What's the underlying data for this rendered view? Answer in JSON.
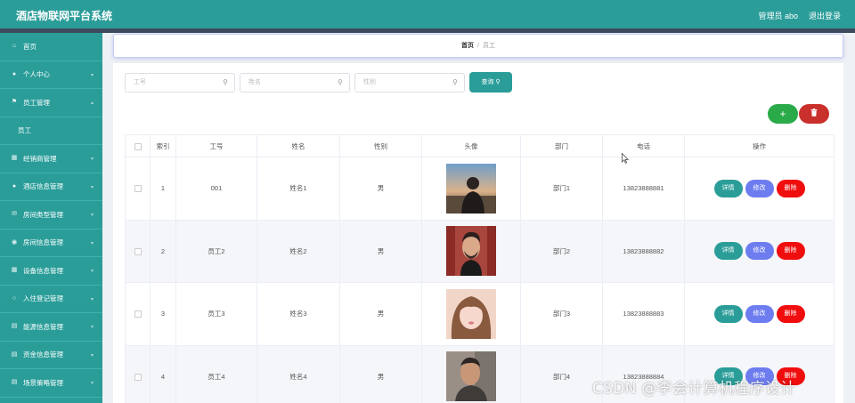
{
  "header": {
    "title": "酒店物联网平台系统",
    "admin": "管理员 abo",
    "logout": "退出登录"
  },
  "colors": {
    "primary": "#2a9d99",
    "success": "#2aaa49",
    "danger": "#c9302c",
    "edit": "#6d7df0",
    "delete": "#f00d0d"
  },
  "sidebar": {
    "items": [
      {
        "label": "首页",
        "icon": "home-icon"
      },
      {
        "label": "个人中心",
        "icon": "user-icon"
      },
      {
        "label": "员工管理",
        "icon": "flag-icon"
      },
      {
        "label": "员工",
        "icon": ""
      },
      {
        "label": "经销商管理",
        "icon": "store-icon"
      },
      {
        "label": "酒店信息管理",
        "icon": "user-icon"
      },
      {
        "label": "房间类型管理",
        "icon": "mail-icon"
      },
      {
        "label": "房间信息管理",
        "icon": "location-icon"
      },
      {
        "label": "设备信息管理",
        "icon": "grid-icon"
      },
      {
        "label": "入住登记管理",
        "icon": "pin-icon"
      },
      {
        "label": "能源信息管理",
        "icon": "grid-icon"
      },
      {
        "label": "资金信息管理",
        "icon": "grid-icon"
      },
      {
        "label": "场景策略管理",
        "icon": "grid-icon"
      }
    ]
  },
  "breadcrumb": {
    "home": "首页",
    "current": "员工"
  },
  "search": {
    "id_placeholder": "工号",
    "name_placeholder": "姓名",
    "gender_placeholder": "性别",
    "query_label": "查询"
  },
  "toolbar": {
    "add_label": "+"
  },
  "table": {
    "headers": [
      "索引",
      "工号",
      "姓名",
      "性别",
      "头像",
      "部门",
      "电话",
      "操作"
    ],
    "rows": [
      {
        "index": "1",
        "id": "001",
        "name": "姓名1",
        "gender": "男",
        "dept": "部门1",
        "phone": "13823888881"
      },
      {
        "index": "2",
        "id": "员工2",
        "name": "姓名2",
        "gender": "男",
        "dept": "部门2",
        "phone": "13823888882"
      },
      {
        "index": "3",
        "id": "员工3",
        "name": "姓名3",
        "gender": "男",
        "dept": "部门3",
        "phone": "13823888883"
      },
      {
        "index": "4",
        "id": "员工4",
        "name": "姓名4",
        "gender": "男",
        "dept": "部门4",
        "phone": "13823888884"
      }
    ],
    "actions": {
      "detail": "详情",
      "edit": "修改",
      "delete": "删除"
    }
  },
  "watermark": "CSDN @李会计算机程序设计"
}
